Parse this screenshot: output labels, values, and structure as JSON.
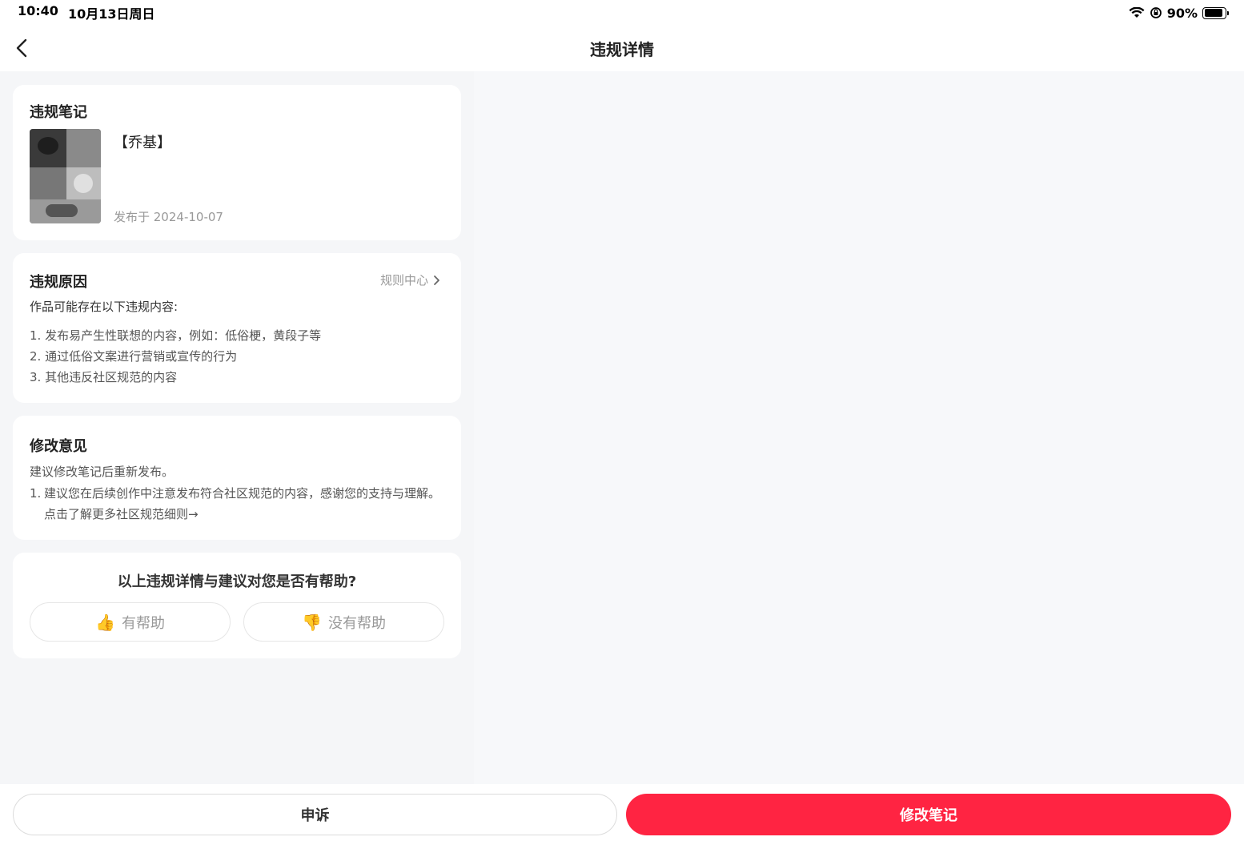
{
  "status_bar": {
    "time": "10:40",
    "date": "10月13日周日",
    "battery": "90%",
    "battery_level": 0.9,
    "icons": [
      "wifi-icon",
      "orientation-lock-icon",
      "battery-icon"
    ]
  },
  "nav": {
    "title": "违规详情",
    "back_icon": "chevron-left-icon"
  },
  "note_card": {
    "title": "违规笔记",
    "note_name": "【乔基】",
    "publish_date": "发布于 2024-10-07"
  },
  "reason_card": {
    "title": "违规原因",
    "rule_link": "规则中心",
    "intro": "作品可能存在以下违规内容:",
    "items": [
      "1.  发布易产生性联想的内容，例如：低俗梗，黄段子等",
      "2.  通过低俗文案进行营销或宣传的行为",
      "3.  其他违反社区规范的内容"
    ]
  },
  "advice_card": {
    "title": "修改意见",
    "intro": "建议修改笔记后重新发布。",
    "item_num": "1.",
    "item_text": "建议您在后续创作中注意发布符合社区规范的内容，感谢您的支持与理解。点击了解更多社区规范细则→"
  },
  "feedback_card": {
    "question": "以上违规详情与建议对您是否有帮助?",
    "helpful": "有帮助",
    "not_helpful": "没有帮助"
  },
  "bottom_bar": {
    "appeal": "申诉",
    "edit": "修改笔记"
  },
  "colors": {
    "accent": "#ff2442",
    "background": "#f5f6f8",
    "card": "#ffffff"
  }
}
